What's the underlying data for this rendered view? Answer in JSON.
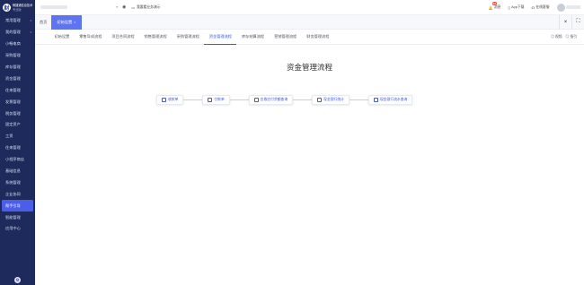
{
  "brand": {
    "logo": "财",
    "name": "畅捷通信息技术",
    "sub": "专业版"
  },
  "sidebar": {
    "items": [
      {
        "label": "常用管理",
        "caret": "▾"
      },
      {
        "label": "我的管理",
        "caret": "▾"
      },
      {
        "label": "小畅电商"
      },
      {
        "label": "采购管理"
      },
      {
        "label": "库存管理"
      },
      {
        "label": "资金管理"
      },
      {
        "label": "往来管理"
      },
      {
        "label": "发票管理"
      },
      {
        "label": "税务管理"
      },
      {
        "label": "固定资产"
      },
      {
        "label": "工资"
      },
      {
        "label": "往来管理"
      },
      {
        "label": "小程序商店"
      },
      {
        "label": "基础信息"
      },
      {
        "label": "系统管理"
      },
      {
        "label": "企业协同"
      },
      {
        "label": "帮手引导",
        "active": true
      },
      {
        "label": "智能管理"
      },
      {
        "label": "应用中心"
      }
    ],
    "footer_icon": "gear-icon"
  },
  "topbar": {
    "platform_link": "我要看业务演示",
    "tools": [
      {
        "label": "消息",
        "badge": "99",
        "icon": "bell-icon"
      },
      {
        "label": "App下载",
        "icon": "phone-icon"
      },
      {
        "label": "在线客服",
        "icon": "headset-icon"
      }
    ]
  },
  "page_tabs": [
    {
      "label": "首页"
    },
    {
      "label": "初始设置",
      "active": true,
      "close": "×"
    }
  ],
  "page_tabs_close": "×",
  "subtabs": [
    {
      "label": "初始设置"
    },
    {
      "label": "零售导成流程"
    },
    {
      "label": "项目合同流程"
    },
    {
      "label": "销售管理流程"
    },
    {
      "label": "采购管理流程"
    },
    {
      "label": "资金管理流程",
      "active": true
    },
    {
      "label": "库存结算流程"
    },
    {
      "label": "营销管理流程"
    },
    {
      "label": "财务管理流程"
    }
  ],
  "subtabs_right": [
    "◎ 视频",
    "◎ 指引"
  ],
  "main": {
    "title": "资金管理流程",
    "flow": [
      {
        "label": "收款单",
        "icon": "receipt-icon"
      },
      {
        "label": "付款单",
        "icon": "payment-icon"
      },
      {
        "label": "应收应付余额查询",
        "icon": "balance-icon"
      },
      {
        "label": "现金银行统计",
        "icon": "bank-icon"
      },
      {
        "label": "现金银行流水查询",
        "icon": "ledger-icon"
      }
    ]
  },
  "colors": {
    "sidebar_bg": "#1f2a5c",
    "accent": "#3d57e6",
    "active_tab": "#5e74f0"
  }
}
